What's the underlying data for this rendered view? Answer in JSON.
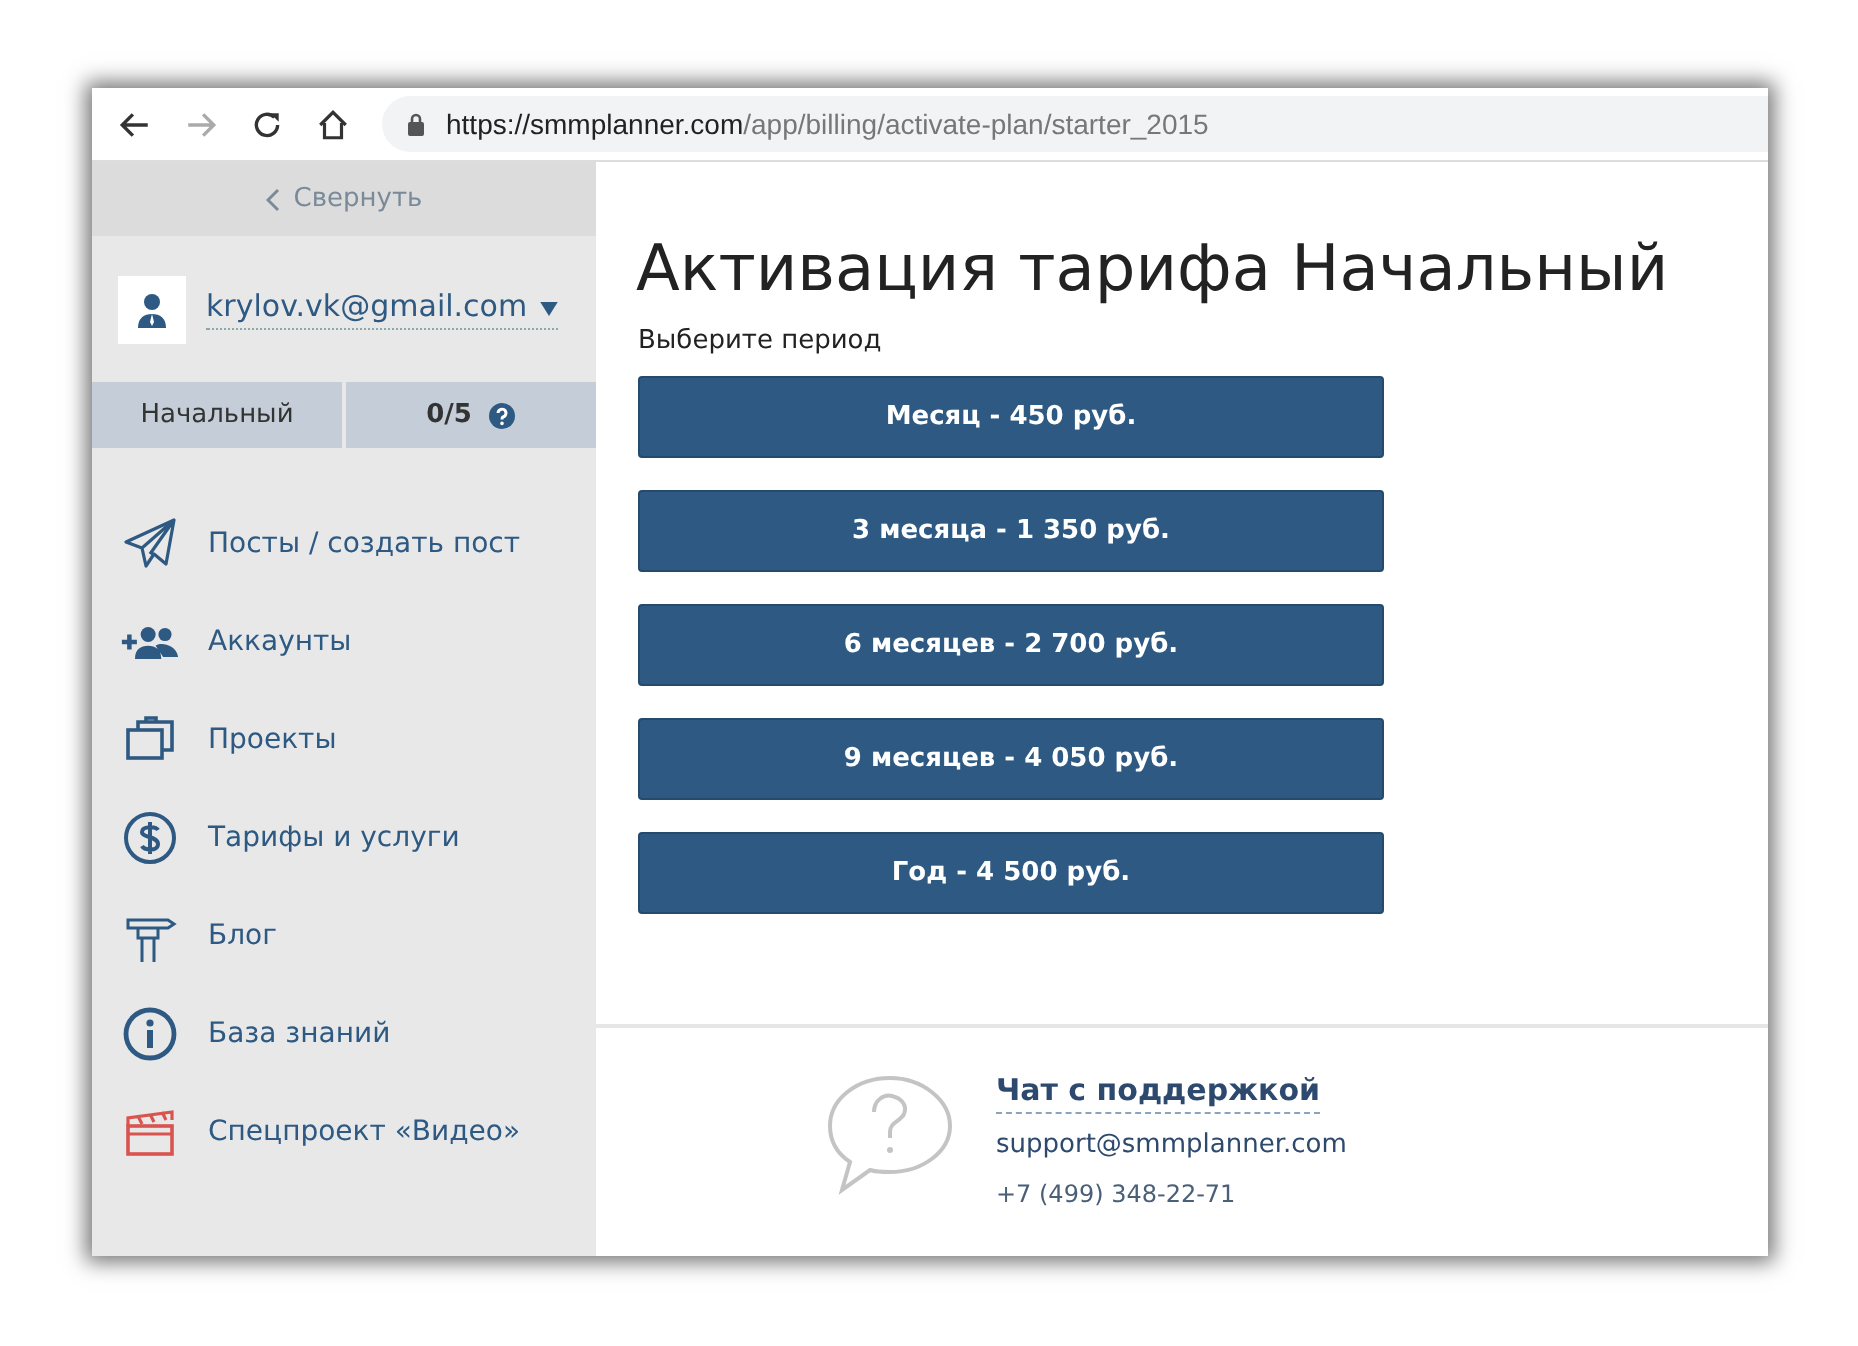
{
  "browser": {
    "url_host": "https://smmplanner.com",
    "url_path": "/app/billing/activate-plan/starter_2015"
  },
  "sidebar": {
    "collapse": "Свернуть",
    "user": "krylov.vk@gmail.com",
    "plan": "Начальный",
    "usage": "0/5",
    "items": [
      {
        "label": "Посты / создать пост"
      },
      {
        "label": "Аккаунты"
      },
      {
        "label": "Проекты"
      },
      {
        "label": "Тарифы и услуги"
      },
      {
        "label": "Блог"
      },
      {
        "label": "База знаний"
      },
      {
        "label": "Спецпроект «Видео»"
      }
    ]
  },
  "main": {
    "title": "Активация тарифа Начальный",
    "subtitle": "Выберите период",
    "periods": [
      "Месяц - 450 руб.",
      "3 месяца - 1 350 руб.",
      "6 месяцев - 2 700 руб.",
      "9 месяцев - 4 050 руб.",
      "Год - 4 500 руб."
    ]
  },
  "footer": {
    "chat": "Чат с поддержкой",
    "email": "support@smmplanner.com",
    "phone": "+7 (499) 348-22-71"
  }
}
